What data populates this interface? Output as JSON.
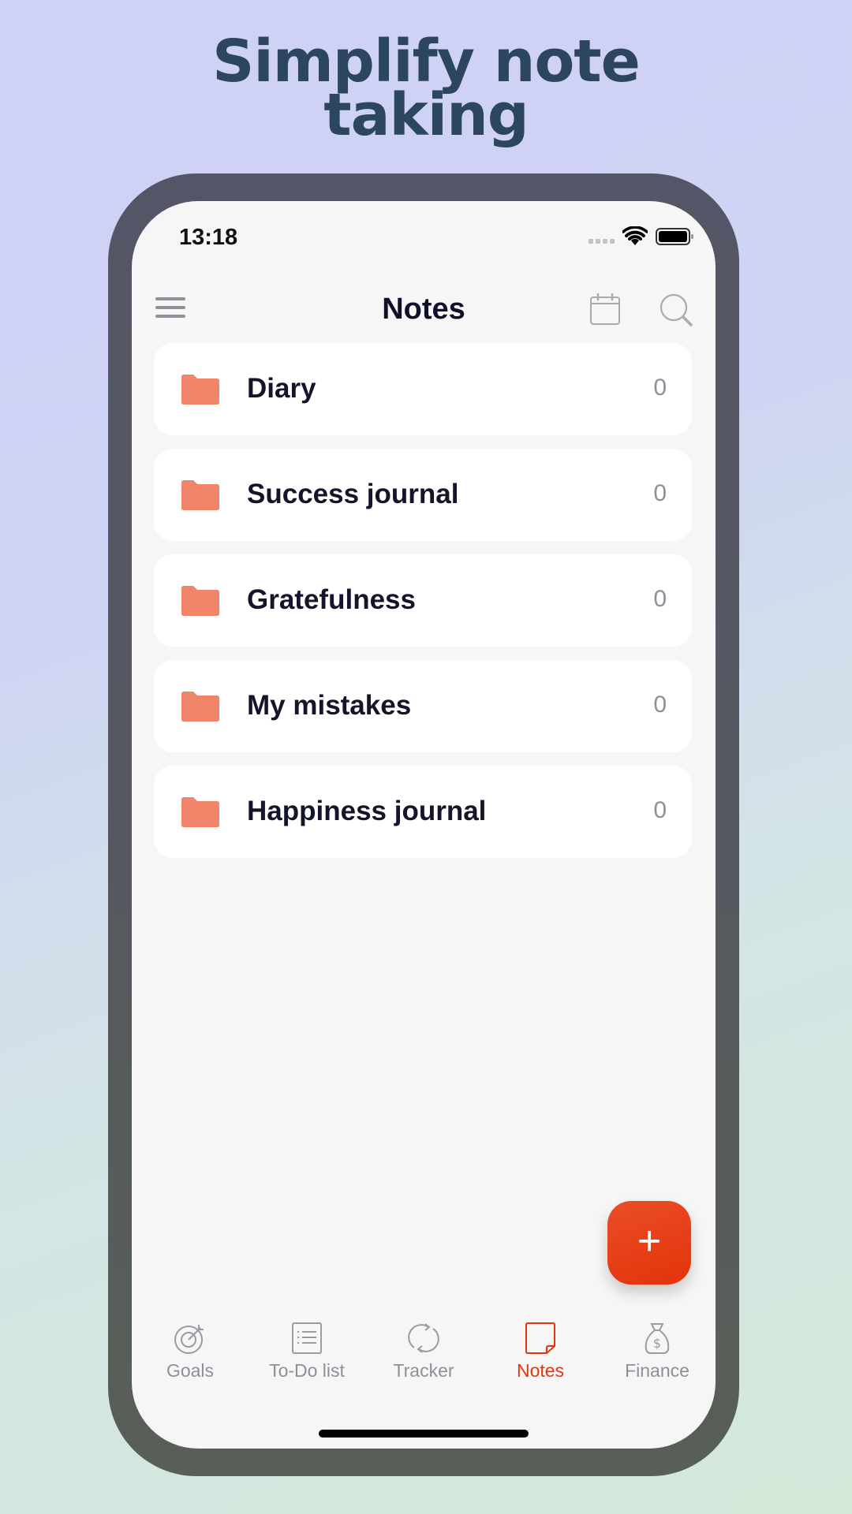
{
  "headline": {
    "line1": "Simplify note",
    "line2": "taking"
  },
  "status_bar": {
    "time": "13:18"
  },
  "nav": {
    "title": "Notes",
    "menu_icon": "hamburger-menu-icon",
    "calendar_icon": "calendar-icon",
    "search_icon": "search-icon"
  },
  "folders": [
    {
      "name": "Diary",
      "count": "0"
    },
    {
      "name": "Success journal",
      "count": "0"
    },
    {
      "name": "Gratefulness",
      "count": "0"
    },
    {
      "name": "My mistakes",
      "count": "0"
    },
    {
      "name": "Happiness journal",
      "count": "0"
    }
  ],
  "fab": {
    "label": "+"
  },
  "tabs": [
    {
      "label": "Goals",
      "icon": "target-icon",
      "active": false
    },
    {
      "label": "To-Do list",
      "icon": "list-icon",
      "active": false
    },
    {
      "label": "Tracker",
      "icon": "refresh-icon",
      "active": false
    },
    {
      "label": "Notes",
      "icon": "note-icon",
      "active": true
    },
    {
      "label": "Finance",
      "icon": "money-bag-icon",
      "active": false
    }
  ],
  "colors": {
    "accent": "#e0370f",
    "folder": "#f0856a",
    "headline": "#2c475d",
    "text_primary": "#14142b",
    "text_muted": "#8e8f99"
  }
}
